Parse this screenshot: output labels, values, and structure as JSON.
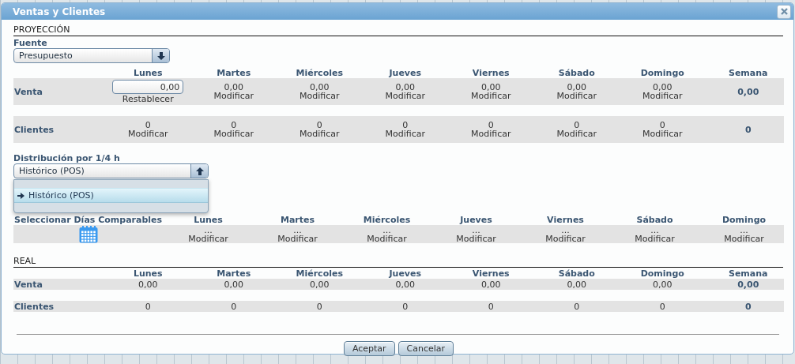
{
  "window": {
    "title": "Ventas y Clientes"
  },
  "proyeccion": {
    "heading": "PROYECCIÓN",
    "fuente": {
      "label": "Fuente",
      "value": "Presupuesto",
      "expanded": false
    },
    "columns": [
      "Lunes",
      "Martes",
      "Miércoles",
      "Jueves",
      "Viernes",
      "Sábado",
      "Domingo",
      "Semana"
    ],
    "rows": [
      {
        "label": "Venta",
        "cells": [
          {
            "kind": "input",
            "value": "0,00",
            "action": "Restablecer"
          },
          {
            "kind": "link",
            "value": "0,00",
            "action": "Modificar"
          },
          {
            "kind": "link",
            "value": "0,00",
            "action": "Modificar"
          },
          {
            "kind": "link",
            "value": "0,00",
            "action": "Modificar"
          },
          {
            "kind": "link",
            "value": "0,00",
            "action": "Modificar"
          },
          {
            "kind": "link",
            "value": "0,00",
            "action": "Modificar"
          },
          {
            "kind": "link",
            "value": "0,00",
            "action": "Modificar"
          },
          {
            "kind": "total",
            "value": "0,00"
          }
        ]
      },
      {
        "label": "Clientes",
        "cells": [
          {
            "kind": "link",
            "value": "0",
            "action": "Modificar"
          },
          {
            "kind": "link",
            "value": "0",
            "action": "Modificar"
          },
          {
            "kind": "link",
            "value": "0",
            "action": "Modificar"
          },
          {
            "kind": "link",
            "value": "0",
            "action": "Modificar"
          },
          {
            "kind": "link",
            "value": "0",
            "action": "Modificar"
          },
          {
            "kind": "link",
            "value": "0",
            "action": "Modificar"
          },
          {
            "kind": "link",
            "value": "0",
            "action": "Modificar"
          },
          {
            "kind": "total",
            "value": "0"
          }
        ]
      }
    ]
  },
  "distribucion": {
    "label": "Distribución por 1/4 h",
    "value": "Histórico (POS)",
    "expanded": true,
    "options": [
      {
        "label": "Histórico (POS)",
        "selected": true
      }
    ]
  },
  "comparables": {
    "label": "Seleccionar Días Comparables",
    "columns": [
      "Lunes",
      "Martes",
      "Miércoles",
      "Jueves",
      "Viernes",
      "Sábado",
      "Domingo"
    ],
    "cells": [
      {
        "value": "...",
        "action": "Modificar"
      },
      {
        "value": "...",
        "action": "Modificar"
      },
      {
        "value": "...",
        "action": "Modificar"
      },
      {
        "value": "...",
        "action": "Modificar"
      },
      {
        "value": "...",
        "action": "Modificar"
      },
      {
        "value": "...",
        "action": "Modificar"
      },
      {
        "value": "...",
        "action": "Modificar"
      }
    ]
  },
  "real": {
    "heading": "REAL",
    "columns": [
      "Lunes",
      "Martes",
      "Miércoles",
      "Jueves",
      "Viernes",
      "Sábado",
      "Domingo",
      "Semana"
    ],
    "rows": [
      {
        "label": "Venta",
        "cells": [
          {
            "kind": "plain",
            "value": "0,00"
          },
          {
            "kind": "plain",
            "value": "0,00"
          },
          {
            "kind": "plain",
            "value": "0,00"
          },
          {
            "kind": "plain",
            "value": "0,00"
          },
          {
            "kind": "plain",
            "value": "0,00"
          },
          {
            "kind": "plain",
            "value": "0,00"
          },
          {
            "kind": "plain",
            "value": "0,00"
          },
          {
            "kind": "total",
            "value": "0,00"
          }
        ]
      },
      {
        "label": "Clientes",
        "cells": [
          {
            "kind": "plain",
            "value": "0"
          },
          {
            "kind": "plain",
            "value": "0"
          },
          {
            "kind": "plain",
            "value": "0"
          },
          {
            "kind": "plain",
            "value": "0"
          },
          {
            "kind": "plain",
            "value": "0"
          },
          {
            "kind": "plain",
            "value": "0"
          },
          {
            "kind": "plain",
            "value": "0"
          },
          {
            "kind": "total",
            "value": "0"
          }
        ]
      }
    ]
  },
  "buttons": [
    "Aceptar",
    "Cancelar"
  ]
}
